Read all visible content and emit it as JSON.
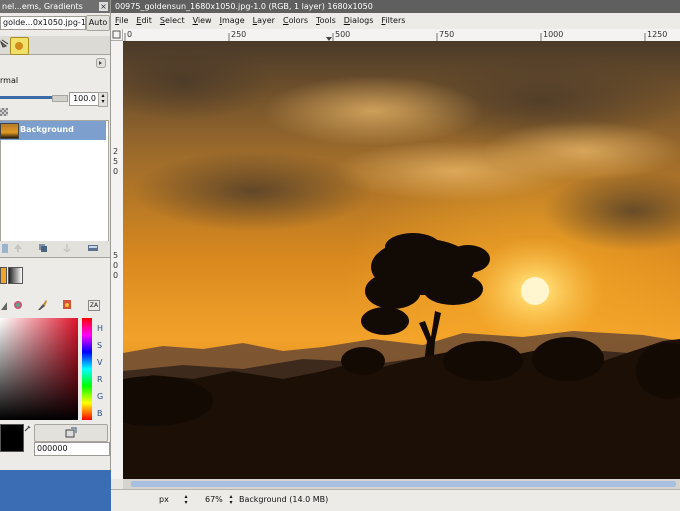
{
  "dock": {
    "title": "nel...ems, Gradients",
    "close_glyph": "×",
    "image_menu": "golde...0x1050.jpg-1",
    "auto_label": "Auto",
    "mode": "rmal",
    "opacity_value": "100.0",
    "layer_name": "Background",
    "fg_hex": "000000",
    "channel_labels": [
      "H",
      "S",
      "V",
      "R",
      "G",
      "B"
    ]
  },
  "window": {
    "title": "00975_goldensun_1680x1050.jpg-1.0 (RGB, 1 layer) 1680x1050",
    "menus": [
      "File",
      "Edit",
      "Select",
      "View",
      "Image",
      "Layer",
      "Colors",
      "Tools",
      "Dialogs",
      "Filters"
    ],
    "ruler_h": [
      "0",
      "250",
      "500",
      "750",
      "1000",
      "1250"
    ],
    "ruler_v": [
      "2",
      "5",
      "0",
      "5",
      "0",
      "0"
    ]
  },
  "status": {
    "unit": "px",
    "zoom": "67%",
    "info": "Background (14.0 MB)"
  },
  "colors": {
    "titlebar": "#6f6f6f",
    "selection": "#7d9fce",
    "desktop": "#3b6db4"
  },
  "icons": [
    "close-icon",
    "chevron-icon",
    "lock-icon",
    "layer-thumbnail",
    "new-layer-icon",
    "raise-layer-icon",
    "duplicate-layer-icon",
    "anchor-icon",
    "delete-layer-icon",
    "triangle-picker-icon",
    "watercolor-icon",
    "brush-icon",
    "cmyk-icon",
    "color-history-icon",
    "navigate-icon"
  ]
}
